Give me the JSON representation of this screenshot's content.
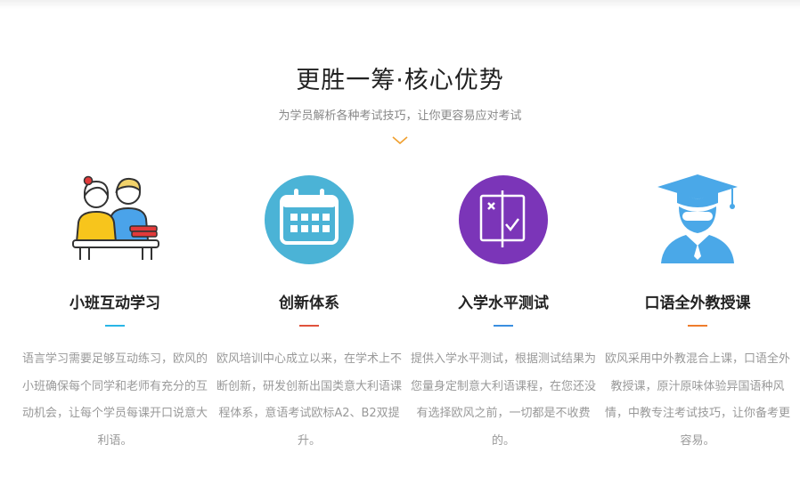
{
  "section": {
    "title": "更胜一筹·核心优势",
    "subtitle": "为学员解析各种考试技巧，让你更容易应对考试",
    "chevron_icon": "chevron-down-icon",
    "chevron_color": "#f0a030"
  },
  "features": [
    {
      "icon": "teacher-student-icon",
      "title": "小班互动学习",
      "accent": "#29b6e6",
      "description": "语言学习需要足够互动练习，欧风的小班确保每个同学和老师有充分的互动机会，让每个学员每课开口说意大利语。"
    },
    {
      "icon": "calendar-icon",
      "title": "创新体系",
      "accent": "#e0523c",
      "description": "欧风培训中心成立以来，在学术上不断创新，研发创新出国类意大利语课程体系，意语考试欧标A2、B2双提升。"
    },
    {
      "icon": "test-check-icon",
      "title": "入学水平测试",
      "accent": "#3a8fe0",
      "description": "提供入学水平测试，根据测试结果为您量身定制意大利语课程，在您还没有选择欧风之前，一切都是不收费的。"
    },
    {
      "icon": "graduate-icon",
      "title": "口语全外教授课",
      "accent": "#ef7c2c",
      "description": "欧风采用中外教混合上课，口语全外教授课，原汁原味体验异国语种风情，中教专注考试技巧，让你备考更容易。"
    }
  ]
}
